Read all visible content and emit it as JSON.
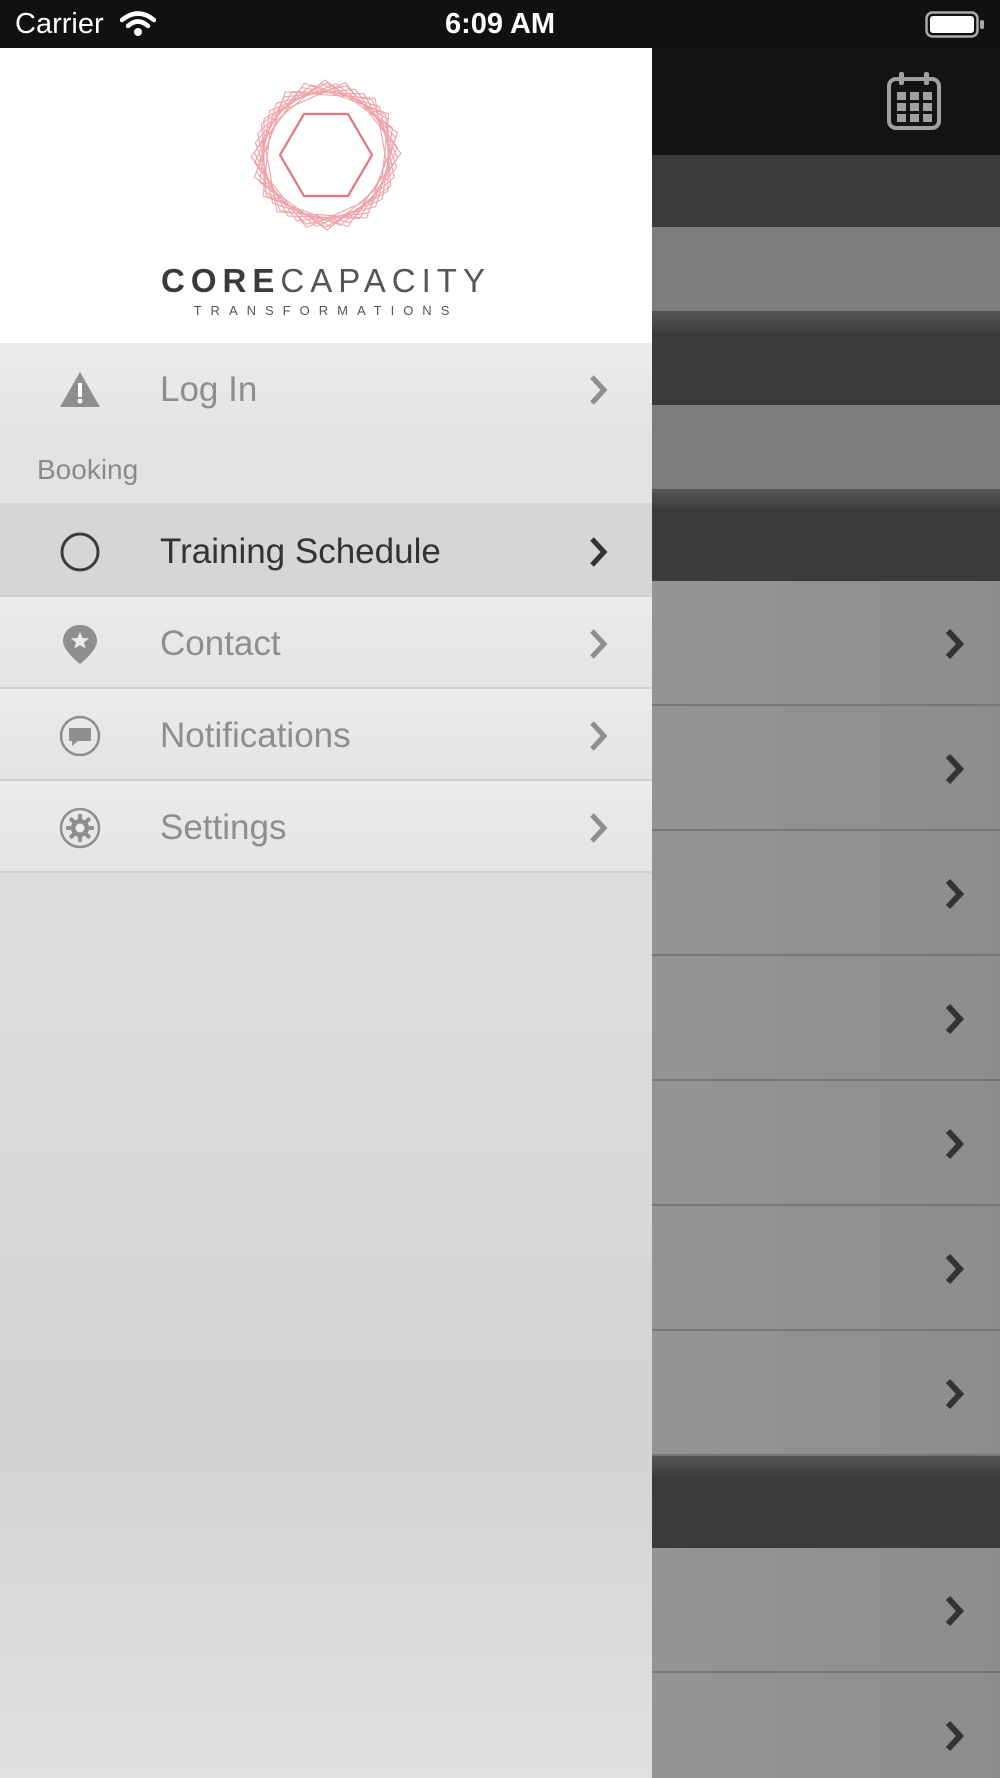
{
  "status_bar": {
    "carrier": "Carrier",
    "time": "6:09 AM"
  },
  "brand": {
    "name_bold": "CORE",
    "name_light": "CAPACITY",
    "tagline": "TRANSFORMATIONS",
    "accent_color": "#e05a66"
  },
  "menu": {
    "login": {
      "label": "Log In",
      "icon": "warning-icon"
    },
    "section_header": "Booking",
    "items": [
      {
        "label": "Training Schedule",
        "icon": "circle-icon",
        "selected": true
      },
      {
        "label": "Contact",
        "icon": "location-pin-star-icon",
        "selected": false
      },
      {
        "label": "Notifications",
        "icon": "chat-bubble-icon",
        "selected": false
      },
      {
        "label": "Settings",
        "icon": "gear-icon",
        "selected": false
      }
    ]
  },
  "background_app": {
    "header_icon": "calendar-icon"
  }
}
